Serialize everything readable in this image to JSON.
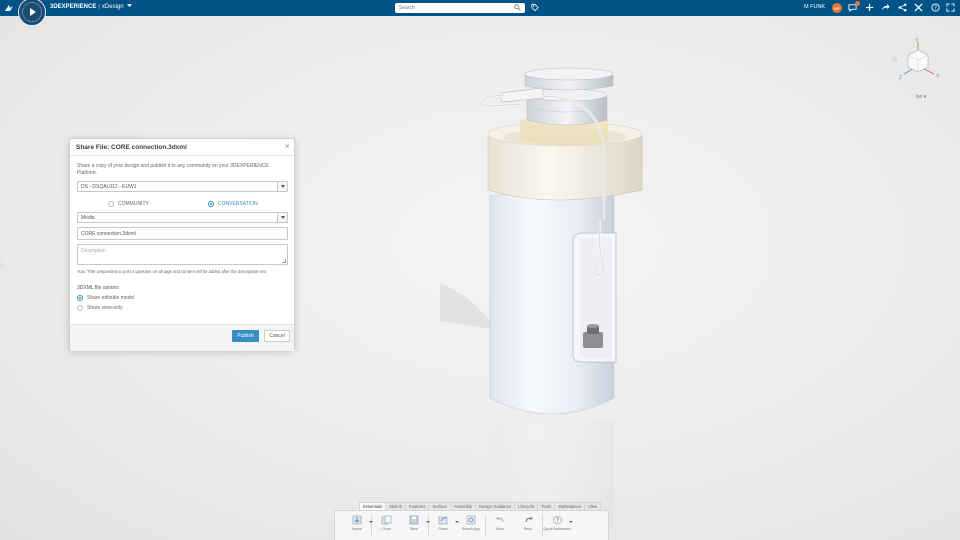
{
  "header": {
    "brand": "3DEXPERIENCE",
    "separator": "|",
    "app_name": "xDesign",
    "search_placeholder": "Search",
    "user_name": "M FUNK",
    "avatar_initials": "MF",
    "notification_count": "9",
    "brand_color": "#005386"
  },
  "viewcube": {
    "axis_x": "X",
    "axis_y": "Y",
    "axis_z": "Z",
    "view_mode": "iso"
  },
  "dialog": {
    "title": "Share File: CORE connection.3dxml",
    "description": "Share a copy of your design and publish it to any community on your 3DEXPERIENCE Platform.",
    "tenant_value": "DS - DSQAL012 - EUW1",
    "share_type_options": [
      {
        "label": "COMMUNITY",
        "selected": false
      },
      {
        "label": "CONVERSATION",
        "selected": true
      }
    ],
    "conversation_value": "Media",
    "file_name_value": "CORE connection.3dxml",
    "description_placeholder": "Description",
    "hint": "Your 'Title' prepended to post a question on all tags and content will be added after the description text",
    "options_heading": "3DXML file options",
    "file_options": [
      {
        "label": "Share editable model",
        "selected": true
      },
      {
        "label": "Share view-only",
        "selected": false
      }
    ],
    "publish_label": "Publish",
    "cancel_label": "Cancel",
    "accent_color": "#368ec4"
  },
  "actionbar": {
    "tabs": [
      "Essentials",
      "Sketch",
      "Features",
      "Surface",
      "Assembly",
      "Design Guidance",
      "Lifecycle",
      "Tools",
      "Marketplace",
      "View"
    ],
    "active_tab": "Essentials",
    "tools": [
      {
        "label": "Import",
        "icon": "import-icon"
      },
      {
        "label": "Clone",
        "icon": "clone-icon"
      },
      {
        "label": "Save",
        "icon": "save-icon"
      },
      {
        "label": "Share",
        "icon": "share-icon"
      },
      {
        "label": "Search App",
        "icon": "search-app-icon"
      },
      {
        "label": "Undo",
        "icon": "undo-icon"
      },
      {
        "label": "Redo",
        "icon": "redo-icon"
      },
      {
        "label": "Quick Assistance",
        "icon": "help-icon"
      }
    ]
  }
}
